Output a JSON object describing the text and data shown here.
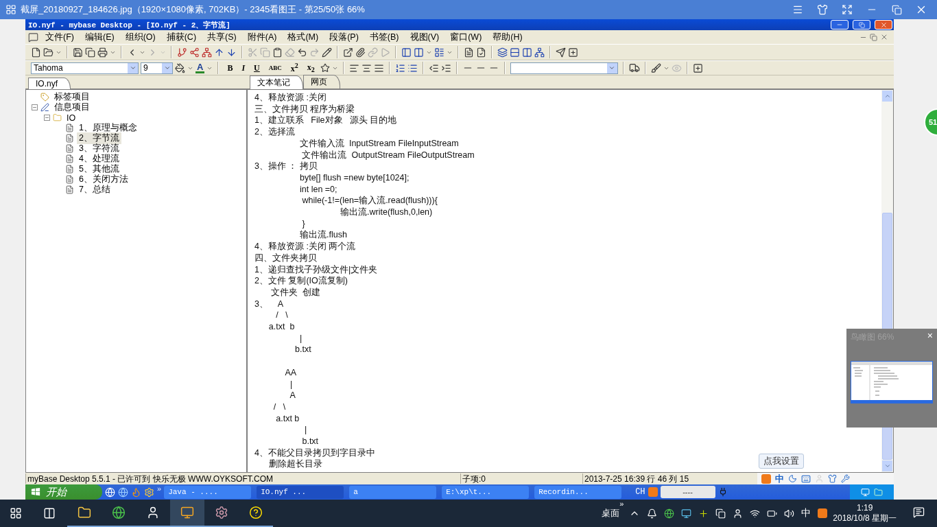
{
  "viewer": {
    "title": "截屏_20180927_184626.jpg（1920×1080像素, 702KB）- 2345看图王 - 第25/50张 66%"
  },
  "side_badge": {
    "text": "51"
  },
  "window": {
    "title": "IO.nyf - mybase Desktop - [IO.nyf - 2、字节流]"
  },
  "menu": [
    "文件(F)",
    "编辑(E)",
    "组织(O)",
    "捕获(C)",
    "共享(S)",
    "附件(A)",
    "格式(M)",
    "段落(P)",
    "书签(B)",
    "视图(V)",
    "窗口(W)",
    "帮助(H)"
  ],
  "format_bar": {
    "font": "Tahoma",
    "size": "9",
    "font_color": "A",
    "styles": [
      "B",
      "I",
      "U",
      "ABC",
      "x$^{2}$",
      "x$_{2}$"
    ]
  },
  "left_tabs": [
    {
      "label": "IO.nyf",
      "selected": true
    }
  ],
  "tree": [
    {
      "label": "标签项目",
      "kind": "tag",
      "selected": false
    },
    {
      "label": "信息项目",
      "kind": "info",
      "selected": false,
      "expanded": true,
      "children": [
        {
          "label": "IO",
          "kind": "folder",
          "selected": false,
          "expanded": true,
          "children": [
            {
              "label": "1、原理与概念",
              "kind": "page",
              "selected": false
            },
            {
              "label": "2、字节流",
              "kind": "page",
              "selected": true
            },
            {
              "label": "3、字符流",
              "kind": "page",
              "selected": false
            },
            {
              "label": "4、处理流",
              "kind": "page",
              "selected": false
            },
            {
              "label": "5、其他流",
              "kind": "page",
              "selected": false
            },
            {
              "label": "6、关闭方法",
              "kind": "page",
              "selected": false
            },
            {
              "label": "7、总结",
              "kind": "page",
              "selected": false
            }
          ]
        }
      ]
    }
  ],
  "editor_tabs": [
    {
      "label": "文本笔记",
      "selected": true
    },
    {
      "label": "网页",
      "selected": false
    }
  ],
  "note_blocks": [
    {
      "lines": [
        "4、释放资源 :关闭",
        "三、文件拷贝 程序为桥梁",
        "1、建立联系   File对象   源头 目的地",
        "2、选择流",
        "                   文件输入流  InputStream FileInputStream",
        "                    文件输出流  OutputStream FileOutputStream",
        "3、操作 ： 拷贝",
        "                   byte[] flush =new byte[1024];",
        "                   int len =0;",
        "                    while(-1!=(len=输入流.read(flush))){",
        "                                    输出流.write(flush,0,len)",
        "                    }",
        "                   输出流.flush",
        "4、释放资源 :关闭 两个流",
        "四、文件夹拷贝",
        "1、递归查找子孙级文件|文件夹",
        "2、文件 复制(IO流复制)",
        "       文件夹  创建",
        "3、    A",
        "         /   \\",
        "      a.txt  b",
        "                   |",
        "                 b.txt"
      ]
    },
    {
      "lines": [
        "             AA",
        "               |",
        "               A",
        "        /   \\",
        "         a.txt b",
        "                     |",
        "                    b.txt",
        "4、不能父目录拷贝到字目录中",
        "      删除超长目录"
      ]
    }
  ],
  "status_bar": {
    "text": "myBase Desktop 5.5.1 - 已许可到 快乐无极 WWW.OYKSOFT.COM",
    "child_count": "子项:0",
    "position": "2013-7-25 16:39 行 46 列 15"
  },
  "ime": {
    "tooltip": "点我设置",
    "mode": "中"
  },
  "xp_taskbar": {
    "start": "开始",
    "more": "»",
    "tasks": [
      {
        "label": "Java - ....",
        "selected": false
      },
      {
        "label": "IO.nyf ...",
        "selected": true
      },
      {
        "label": "a",
        "selected": false
      },
      {
        "label": "E:\\xp\\t...",
        "selected": false
      },
      {
        "label": "Recordin...",
        "selected": false
      }
    ],
    "language": "CH",
    "tray_box": "----"
  },
  "overview": {
    "title": "鸟瞰图 66%",
    "close": "×"
  },
  "taskbar": {
    "apps": [
      {
        "selected": false
      },
      {
        "selected": false
      },
      {
        "selected": false
      },
      {
        "selected": true
      },
      {
        "selected": false
      },
      {
        "selected": false
      }
    ],
    "desktop": "桌面",
    "more": "»",
    "ime": "中",
    "time": "1:19",
    "date": "2018/10/8 星期一"
  }
}
